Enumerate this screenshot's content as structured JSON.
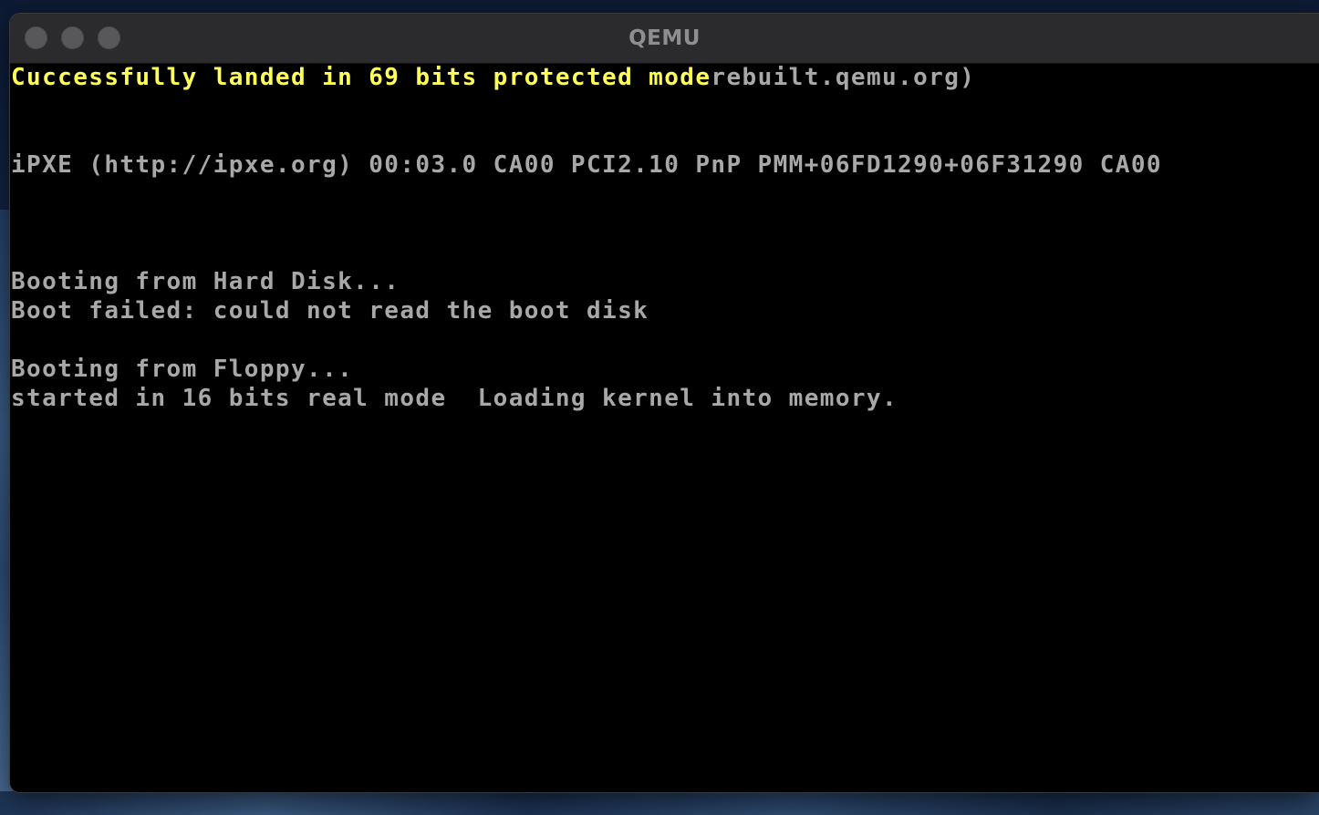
{
  "window": {
    "title": "QEMU"
  },
  "terminal": {
    "colors": {
      "default": "#a8a8a8",
      "highlight": "#ffff55",
      "background": "#000000"
    },
    "line1_highlight": "Cuccessfully landed in 69 bits protected mode",
    "line1_rest": "rebuilt.qemu.org)",
    "ipxe": "iPXE (http://ipxe.org) 00:03.0 CA00 PCI2.10 PnP PMM+06FD1290+06F31290 CA00",
    "boot_hd": "Booting from Hard Disk...",
    "boot_failed": "Boot failed: could not read the boot disk",
    "boot_floppy": "Booting from Floppy...",
    "real_mode": "started in 16 bits real mode  Loading kernel into memory."
  }
}
